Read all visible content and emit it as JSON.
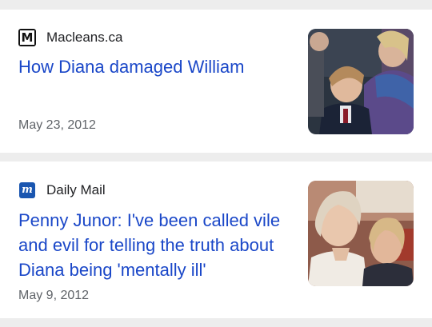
{
  "articles": [
    {
      "source": {
        "name": "Macleans.ca",
        "logo_letter": "M",
        "logo_icon": "macleans-logo-icon"
      },
      "headline": "How Diana damaged William",
      "date": "May 23, 2012",
      "thumbnail": "photo-diana-with-young-william"
    },
    {
      "source": {
        "name": "Daily Mail",
        "logo_letter": "m",
        "logo_icon": "dailymail-logo-icon"
      },
      "headline": "Penny Junor: I've been called vile and evil for telling the truth about Diana being 'mentally ill'",
      "date": "May 9, 2012",
      "thumbnail": "photo-penny-junor-and-diana"
    }
  ],
  "colors": {
    "headline": "#1a47c8",
    "date": "#5f6368",
    "source": "#202124",
    "page_background": "#ededed",
    "card_background": "#ffffff"
  }
}
